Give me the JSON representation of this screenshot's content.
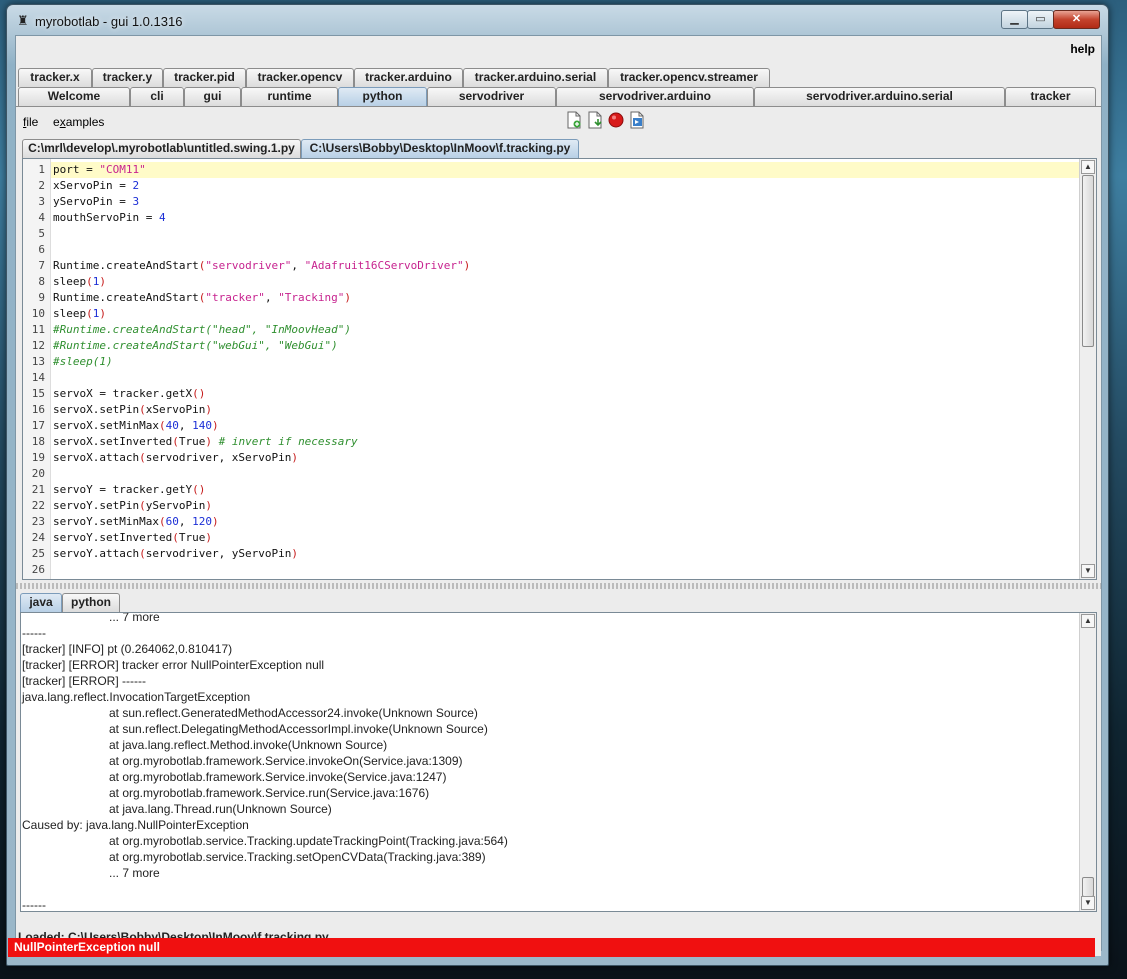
{
  "window": {
    "title": "myrobotlab - gui 1.0.1316",
    "controls": {
      "minimize": "▁",
      "maximize": "▭",
      "close": "✕"
    }
  },
  "menubar": {
    "help": "help"
  },
  "service_tabs_row1": [
    "tracker.x",
    "tracker.y",
    "tracker.pid",
    "tracker.opencv",
    "tracker.arduino",
    "tracker.arduino.serial",
    "tracker.opencv.streamer"
  ],
  "service_tabs_row2": [
    "Welcome",
    "cli",
    "gui",
    "runtime",
    "python",
    "servodriver",
    "servodriver.arduino",
    "servodriver.arduino.serial",
    "tracker"
  ],
  "selected_service_tab": "python",
  "python_menu": {
    "file": "file",
    "examples": "examples"
  },
  "toolbar_icons": [
    "new-file-icon",
    "open-file-icon",
    "stop-icon",
    "execute-icon"
  ],
  "file_tabs": [
    "C:\\mrl\\develop\\.myrobotlab\\untitled.swing.1.py",
    "C:\\Users\\Bobby\\Desktop\\InMoov\\f.tracking.py"
  ],
  "selected_file_tab": 1,
  "code_lines": [
    "port = \"COM11\"",
    "xServoPin = 2",
    "yServoPin = 3",
    "mouthServoPin = 4",
    "",
    "",
    "Runtime.createAndStart(\"servodriver\", \"Adafruit16CServoDriver\")",
    "sleep(1)",
    "Runtime.createAndStart(\"tracker\", \"Tracking\")",
    "sleep(1)",
    "#Runtime.createAndStart(\"head\", \"InMoovHead\")",
    "#Runtime.createAndStart(\"webGui\", \"WebGui\")",
    "#sleep(1)",
    "",
    "servoX = tracker.getX()",
    "servoX.setPin(xServoPin)",
    "servoX.setMinMax(40, 140)",
    "servoX.setInverted(True) # invert if necessary",
    "servoX.attach(servodriver, xServoPin)",
    "",
    "servoY = tracker.getY()",
    "servoY.setPin(yServoPin)",
    "servoY.setMinMax(60, 120)",
    "servoY.setInverted(True)",
    "servoY.attach(servodriver, yServoPin)",
    ""
  ],
  "output_tabs": [
    "java",
    "python"
  ],
  "selected_output_tab": 0,
  "output_lines": [
    {
      "indent": true,
      "text": "... 7 more"
    },
    {
      "indent": false,
      "text": "------"
    },
    {
      "indent": false,
      "text": "[tracker] [INFO] pt (0.264062,0.810417)"
    },
    {
      "indent": false,
      "text": "[tracker] [ERROR] tracker error NullPointerException null"
    },
    {
      "indent": false,
      "text": "[tracker] [ERROR] ------"
    },
    {
      "indent": false,
      "text": "java.lang.reflect.InvocationTargetException"
    },
    {
      "indent": true,
      "text": "at sun.reflect.GeneratedMethodAccessor24.invoke(Unknown Source)"
    },
    {
      "indent": true,
      "text": "at sun.reflect.DelegatingMethodAccessorImpl.invoke(Unknown Source)"
    },
    {
      "indent": true,
      "text": "at java.lang.reflect.Method.invoke(Unknown Source)"
    },
    {
      "indent": true,
      "text": "at org.myrobotlab.framework.Service.invokeOn(Service.java:1309)"
    },
    {
      "indent": true,
      "text": "at org.myrobotlab.framework.Service.invoke(Service.java:1247)"
    },
    {
      "indent": true,
      "text": "at org.myrobotlab.framework.Service.run(Service.java:1676)"
    },
    {
      "indent": true,
      "text": "at java.lang.Thread.run(Unknown Source)"
    },
    {
      "indent": false,
      "text": "Caused by: java.lang.NullPointerException"
    },
    {
      "indent": true,
      "text": "at org.myrobotlab.service.Tracking.updateTrackingPoint(Tracking.java:564)"
    },
    {
      "indent": true,
      "text": "at org.myrobotlab.service.Tracking.setOpenCVData(Tracking.java:389)"
    },
    {
      "indent": true,
      "text": "... 7 more"
    },
    {
      "indent": false,
      "text": ""
    },
    {
      "indent": false,
      "text": "------"
    }
  ],
  "status": {
    "loaded": "Loaded: C:\\Users\\Bobby\\Desktop\\InMoov\\f.tracking.py",
    "error": "NullPointerException null",
    "error_color": "#f01010"
  },
  "colors": {
    "selected_tab": "#b8d0e6",
    "current_line": "#fffbc8",
    "string": "#c7238f",
    "number": "#1c2fd6",
    "comment": "#2f8f2f"
  }
}
